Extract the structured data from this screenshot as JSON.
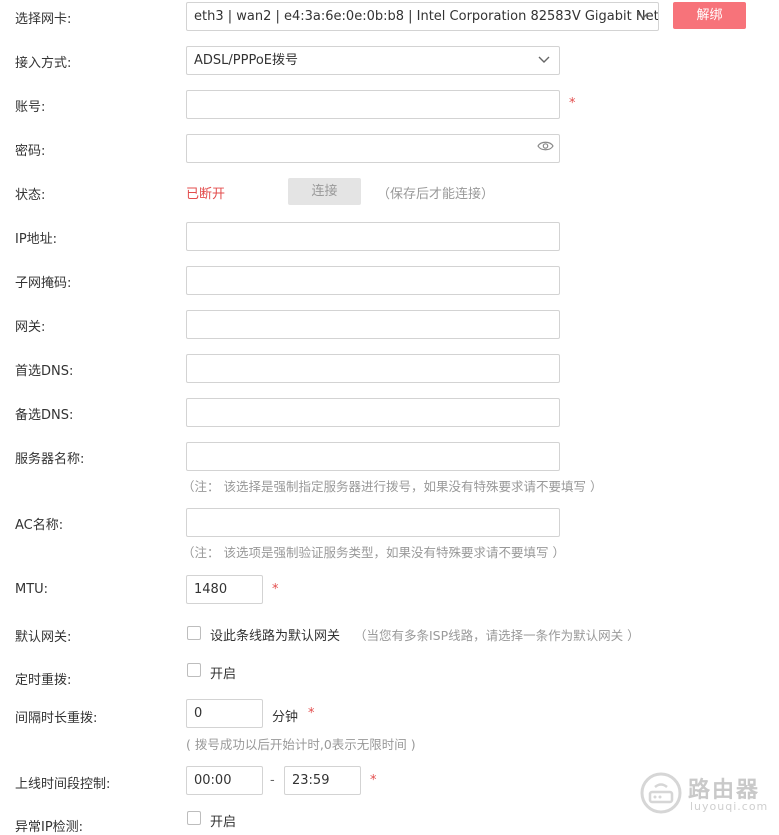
{
  "nic": {
    "label": "选择网卡:",
    "value": "eth3 | wan2 | e4:3a:6e:0e:0b:b8 | Intel Corporation 82583V Gigabit Net",
    "unbind_label": "解绑"
  },
  "access": {
    "label": "接入方式:",
    "value": "ADSL/PPPoE拨号"
  },
  "account": {
    "label": "账号:",
    "value": "",
    "required": "*"
  },
  "password": {
    "label": "密码:",
    "value": ""
  },
  "status": {
    "label": "状态:",
    "value": "已断开",
    "connect_label": "连接",
    "hint": "（保存后才能连接）"
  },
  "ip": {
    "label": "IP地址:",
    "value": ""
  },
  "mask": {
    "label": "子网掩码:",
    "value": ""
  },
  "gateway": {
    "label": "网关:",
    "value": ""
  },
  "dns1": {
    "label": "首选DNS:",
    "value": ""
  },
  "dns2": {
    "label": "备选DNS:",
    "value": ""
  },
  "server_name": {
    "label": "服务器名称:",
    "value": "",
    "hint": "（注：  该选择是强制指定服务器进行拨号，如果没有特殊要求请不要填写 ）"
  },
  "ac_name": {
    "label": "AC名称:",
    "value": "",
    "hint": "（注：  该选项是强制验证服务类型，如果没有特殊要求请不要填写 ）"
  },
  "mtu": {
    "label": "MTU:",
    "value": "1480",
    "required": "*"
  },
  "default_gw": {
    "label": "默认网关:",
    "checkbox_label": "设此条线路为默认网关",
    "hint": "（当您有多条ISP线路，请选择一条作为默认网关 ）"
  },
  "redial": {
    "label": "定时重拨:",
    "checkbox_label": "开启"
  },
  "interval": {
    "label": "间隔时长重拨:",
    "value": "0",
    "unit": "分钟",
    "required": "*",
    "hint": "( 拨号成功以后开始计时,0表示无限时间 )"
  },
  "online_time": {
    "label": "上线时间段控制:",
    "start": "00:00",
    "separator": "-",
    "end": "23:59",
    "required": "*"
  },
  "ip_check": {
    "label": "异常IP检测:",
    "checkbox_label": "开启"
  },
  "watermark": {
    "title": "路由器",
    "subtitle": "luyouqi.com"
  },
  "colors": {
    "accent_red": "#f7737a",
    "required_red": "#e34d4d",
    "hint_gray": "#999999",
    "border": "#d3d3d3"
  }
}
